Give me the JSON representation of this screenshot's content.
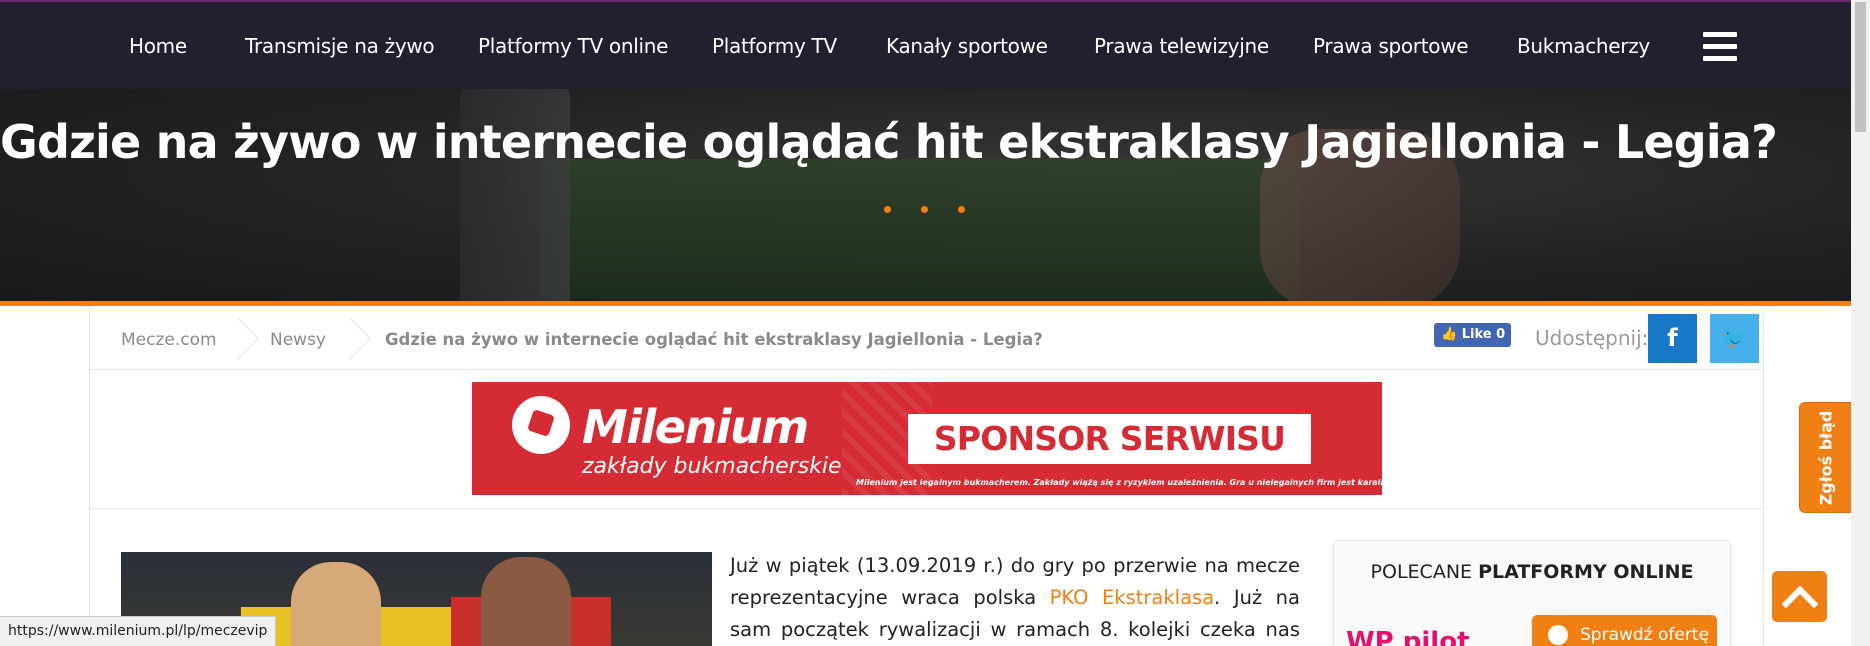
{
  "nav": {
    "items": [
      "Home",
      "Transmisje na żywo",
      "Platformy TV online",
      "Platformy TV",
      "Kanały sportowe",
      "Prawa telewizyjne",
      "Prawa sportowe",
      "Bukmacherzy"
    ]
  },
  "hero": {
    "title": "Gdzie na żywo w internecie oglądać hit ekstraklasy Jagiellonia - Legia?"
  },
  "breadcrumb": {
    "items": [
      "Mecze.com",
      "Newsy",
      "Gdzie na żywo w internecie oglądać hit ekstraklasy Jagiellonia - Legia?"
    ]
  },
  "social": {
    "like_label": "Like 0",
    "share_label": "Udostępnij:",
    "fb_glyph": "f",
    "tw_glyph": "🐦"
  },
  "banner": {
    "logo": "Milenium",
    "logo_sub": "zakłady bukmacherskie",
    "sponsor": "SPONSOR SERWISU",
    "disclaimer": "Milenium jest legalnym bukmacherem. Zakłady wiążą się z ryzykiem uzależnienia. Gra u nielegalnych firm jest karalna."
  },
  "article": {
    "text_before": "Już w piątek (13.09.2019 r.) do gry po przerwie na mecze reprezentacyjne wraca polska ",
    "highlight": "PKO Ekstraklasa",
    "text_after": ". Już na sam początek rywalizacji w ramach 8. kolejki czeka nas hit."
  },
  "sidebar": {
    "header_normal": "POLECANE ",
    "header_bold": "PLATFORMY ONLINE",
    "platform_logo": "WP pilot",
    "check_offer": "Sprawdź ofertę"
  },
  "floating": {
    "report_error": "Zgłoś błąd"
  },
  "status": {
    "url": "https://www.milenium.pl/lp/meczevip"
  },
  "colors": {
    "accent": "#f07f14",
    "nav_bg": "#221f2e",
    "banner_red": "#d42b34",
    "facebook": "#1877c7",
    "twitter": "#45b0ea"
  }
}
